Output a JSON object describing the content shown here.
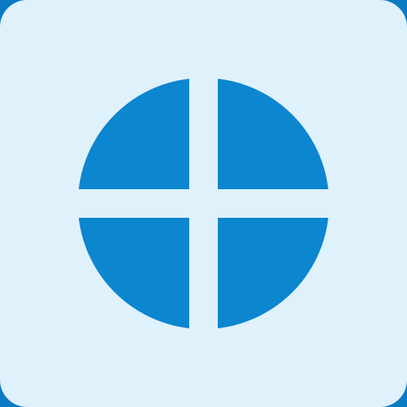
{
  "icon": {
    "name": "globe-quadrants-icon",
    "colors": {
      "frame": "#0a7bc2",
      "card": "#dff1fb",
      "mark": "#0b86cf"
    }
  }
}
